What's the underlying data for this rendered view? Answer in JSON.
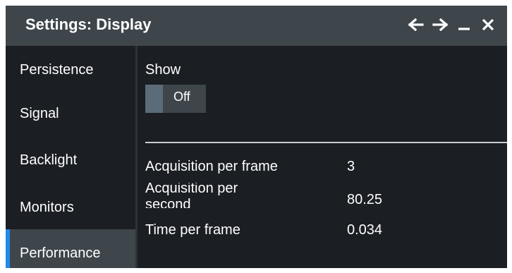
{
  "window": {
    "title": "Settings: Display",
    "controls": [
      "arrow-left-icon",
      "arrow-right-icon",
      "minimize-icon",
      "close-icon"
    ]
  },
  "sidebar": {
    "items": [
      {
        "label": "Persistence",
        "active": false
      },
      {
        "label": "Signal",
        "active": false
      },
      {
        "label": "Backlight",
        "active": false
      },
      {
        "label": "Monitors",
        "active": false
      },
      {
        "label": "Performance",
        "active": true
      }
    ]
  },
  "main": {
    "show_label": "Show",
    "show_toggle": {
      "state": "Off"
    },
    "rows": [
      {
        "label": "Acquisition per frame",
        "value": "3"
      },
      {
        "label": "Acquisition per second",
        "value": "80.25"
      },
      {
        "label": "Time per frame",
        "value": "0.034"
      }
    ]
  },
  "colors": {
    "titlebar": "#3e464c",
    "background": "#1b1e22",
    "active_marker": "#1e8be8",
    "toggle_knob": "#5b6b78"
  }
}
